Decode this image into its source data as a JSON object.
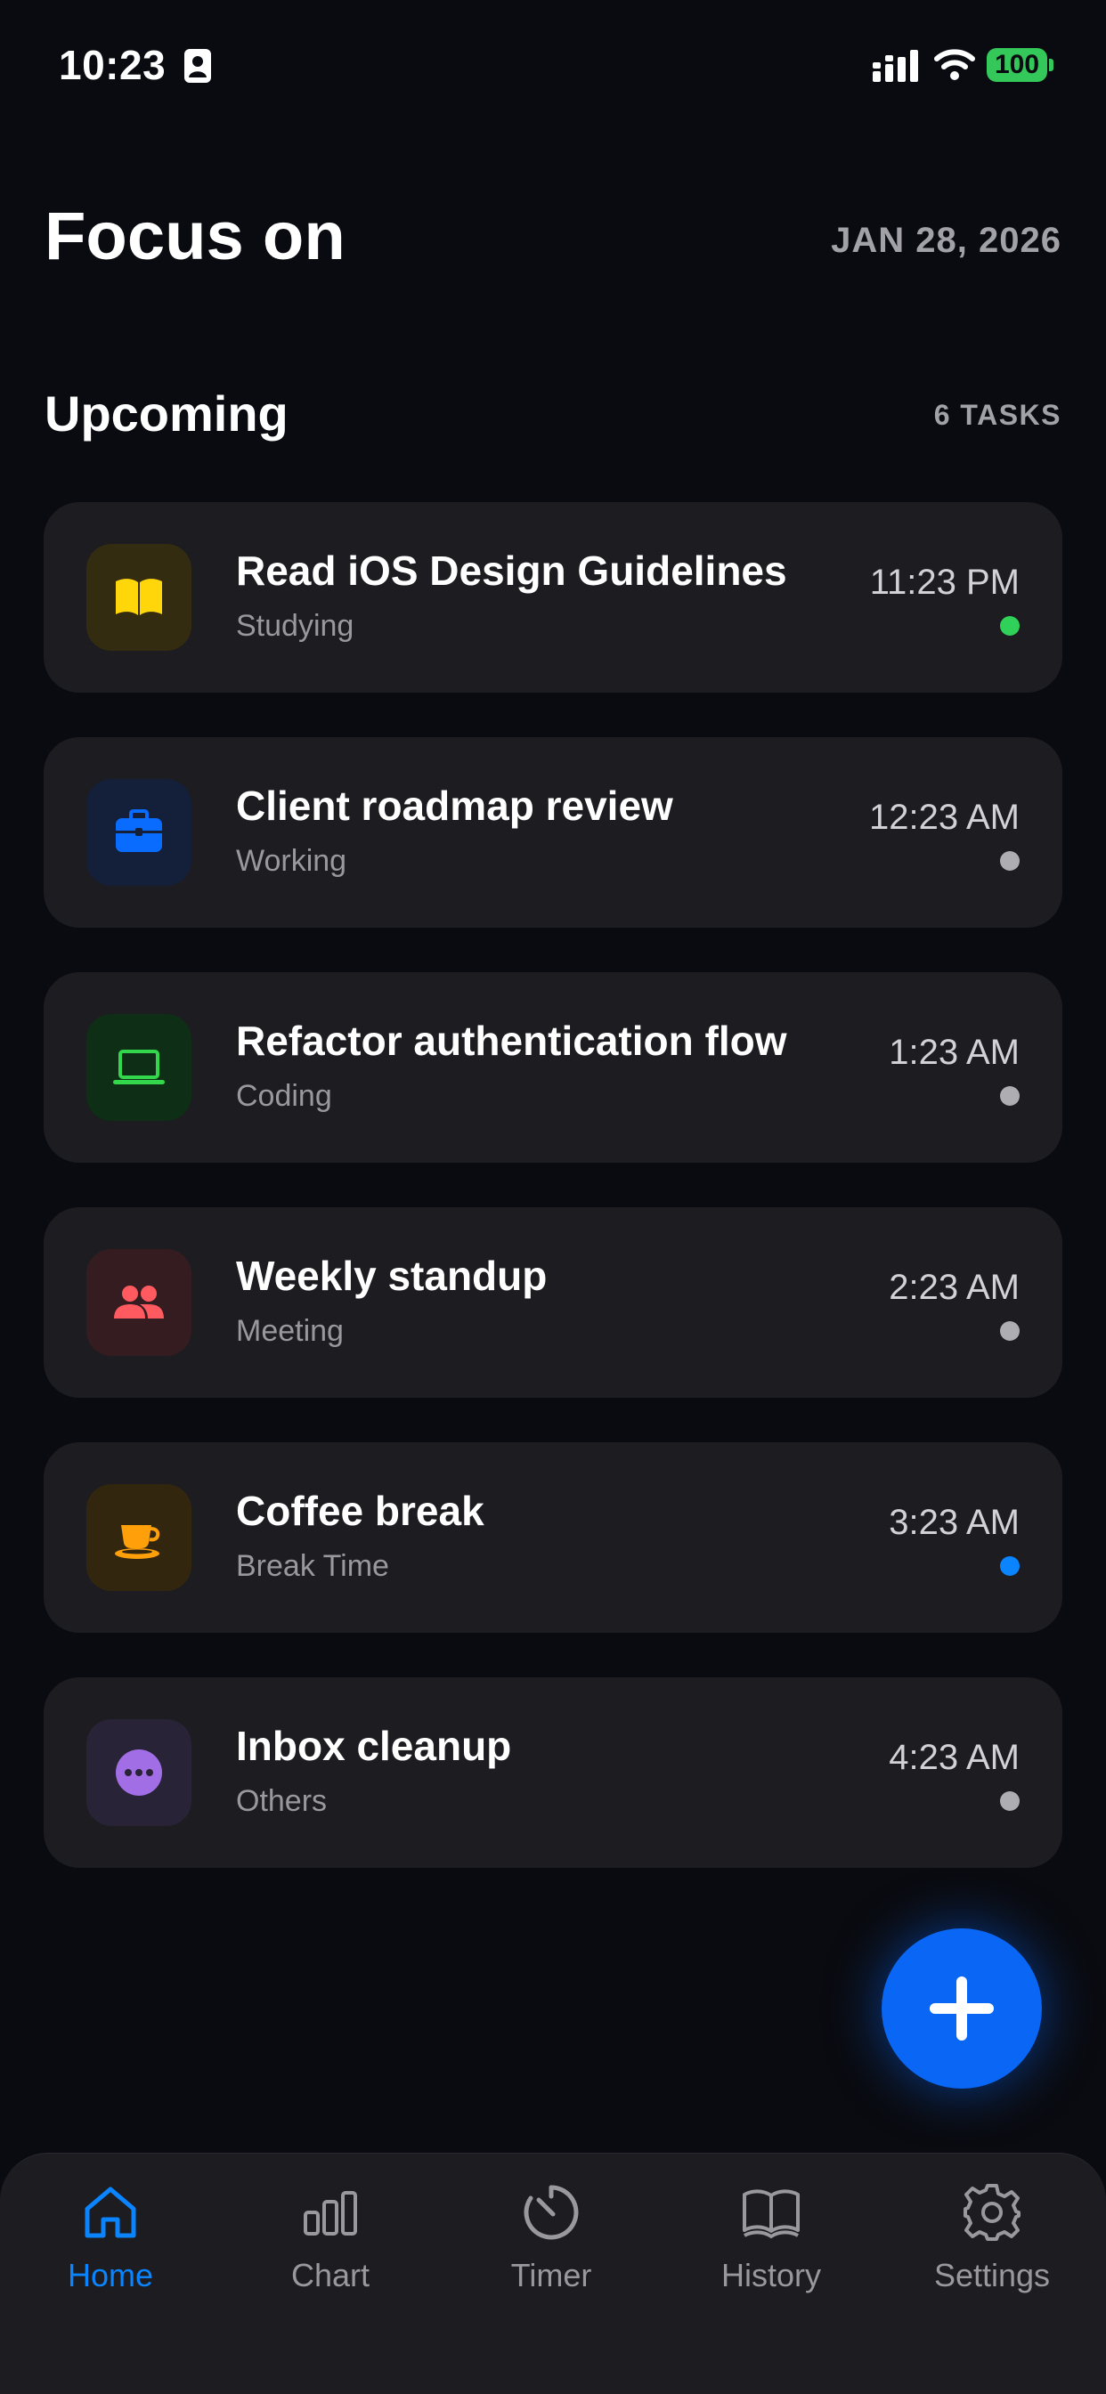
{
  "status_bar": {
    "time": "10:23",
    "battery": "100"
  },
  "header": {
    "title": "Focus on",
    "date": "JAN 28, 2026"
  },
  "section": {
    "title": "Upcoming",
    "count": "6 TASKS"
  },
  "tasks": [
    {
      "title": "Read iOS Design Guidelines",
      "category": "Studying",
      "time": "11:23 PM",
      "icon": "book-icon",
      "tile_color": "#332c10",
      "icon_color": "#ffd60a",
      "dot_color": "#30d158"
    },
    {
      "title": "Client roadmap review",
      "category": "Working",
      "time": "12:23 AM",
      "icon": "briefcase-icon",
      "tile_color": "#14203a",
      "icon_color": "#0a6cff",
      "dot_color": "#aeaeb2"
    },
    {
      "title": "Refactor authentication flow",
      "category": "Coding",
      "time": "1:23 AM",
      "icon": "laptop-icon",
      "tile_color": "#0f2e16",
      "icon_color": "#32d74b",
      "dot_color": "#aeaeb2"
    },
    {
      "title": "Weekly standup",
      "category": "Meeting",
      "time": "2:23 AM",
      "icon": "people-icon",
      "tile_color": "#351c20",
      "icon_color": "#ff5a5f",
      "dot_color": "#aeaeb2"
    },
    {
      "title": "Coffee break",
      "category": "Break Time",
      "time": "3:23 AM",
      "icon": "coffee-cup-icon",
      "tile_color": "#33260f",
      "icon_color": "#ff9f0a",
      "dot_color": "#0a84ff"
    },
    {
      "title": "Inbox cleanup",
      "category": "Others",
      "time": "4:23 AM",
      "icon": "ellipsis-circle-icon",
      "tile_color": "#282336",
      "icon_color": "#a26ee6",
      "dot_color": "#aeaeb2"
    }
  ],
  "fab": {
    "icon": "plus-icon",
    "color": "#0a66f5"
  },
  "tab_bar": {
    "active_color": "#0a84ff",
    "inactive_color": "#98989d",
    "items": [
      {
        "label": "Home",
        "icon": "home-icon",
        "active": true
      },
      {
        "label": "Chart",
        "icon": "bar-chart-icon",
        "active": false
      },
      {
        "label": "Timer",
        "icon": "timer-icon",
        "active": false
      },
      {
        "label": "History",
        "icon": "open-book-icon",
        "active": false
      },
      {
        "label": "Settings",
        "icon": "gear-icon",
        "active": false
      }
    ]
  }
}
